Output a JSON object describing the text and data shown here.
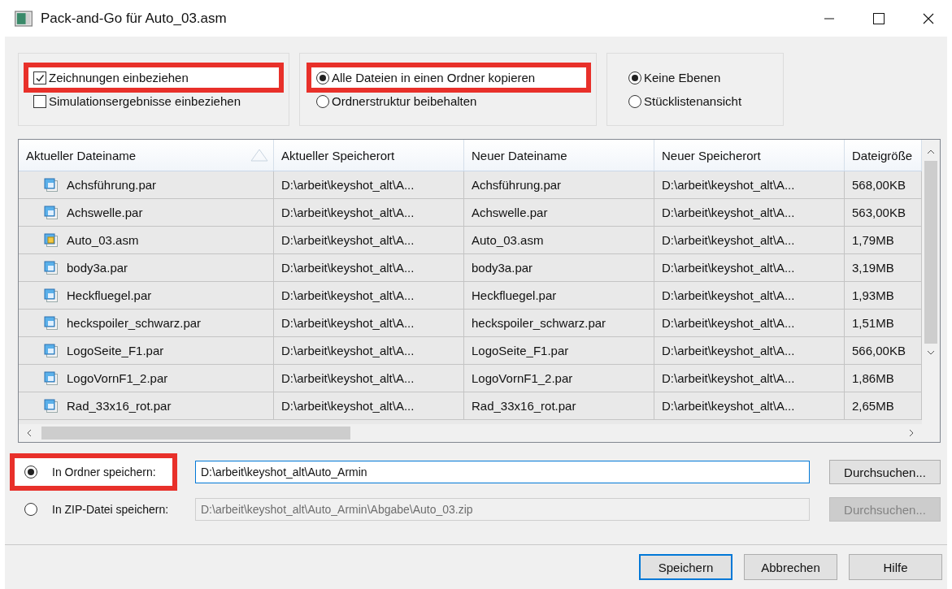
{
  "window": {
    "title": "Pack-and-Go für Auto_03.asm"
  },
  "option_groups": [
    {
      "kind": "checkbox",
      "items": [
        {
          "label": "Zeichnungen einbeziehen",
          "checked": true,
          "highlighted": true
        },
        {
          "label": "Simulationsergebnisse einbeziehen",
          "checked": false,
          "highlighted": false
        }
      ]
    },
    {
      "kind": "radio",
      "items": [
        {
          "label": "Alle Dateien in einen Ordner kopieren",
          "selected": true,
          "highlighted": true
        },
        {
          "label": "Ordnerstruktur beibehalten",
          "selected": false,
          "highlighted": false
        }
      ]
    },
    {
      "kind": "radio",
      "items": [
        {
          "label": "Keine Ebenen",
          "selected": true,
          "highlighted": false
        },
        {
          "label": "Stücklistenansicht",
          "selected": false,
          "highlighted": false
        }
      ]
    }
  ],
  "table": {
    "columns": [
      "Aktueller Dateiname",
      "Aktueller Speicherort",
      "Neuer Dateiname",
      "Neuer Speicherort",
      "Dateigröße"
    ],
    "rows": [
      {
        "kind": "part",
        "cells": [
          "Achsführung.par",
          "D:\\arbeit\\keyshot_alt\\A...",
          "Achsführung.par",
          "D:\\arbeit\\keyshot_alt\\A...",
          "568,00KB"
        ]
      },
      {
        "kind": "part",
        "cells": [
          "Achswelle.par",
          "D:\\arbeit\\keyshot_alt\\A...",
          "Achswelle.par",
          "D:\\arbeit\\keyshot_alt\\A...",
          "563,00KB"
        ]
      },
      {
        "kind": "assembly",
        "cells": [
          "Auto_03.asm",
          "D:\\arbeit\\keyshot_alt\\A...",
          "Auto_03.asm",
          "D:\\arbeit\\keyshot_alt\\A...",
          "1,79MB"
        ]
      },
      {
        "kind": "part",
        "cells": [
          "body3a.par",
          "D:\\arbeit\\keyshot_alt\\A...",
          "body3a.par",
          "D:\\arbeit\\keyshot_alt\\A...",
          "3,19MB"
        ]
      },
      {
        "kind": "part",
        "cells": [
          "Heckfluegel.par",
          "D:\\arbeit\\keyshot_alt\\A...",
          "Heckfluegel.par",
          "D:\\arbeit\\keyshot_alt\\A...",
          "1,93MB"
        ]
      },
      {
        "kind": "part",
        "cells": [
          "heckspoiler_schwarz.par",
          "D:\\arbeit\\keyshot_alt\\A...",
          "heckspoiler_schwarz.par",
          "D:\\arbeit\\keyshot_alt\\A...",
          "1,51MB"
        ]
      },
      {
        "kind": "part",
        "cells": [
          "LogoSeite_F1.par",
          "D:\\arbeit\\keyshot_alt\\A...",
          "LogoSeite_F1.par",
          "D:\\arbeit\\keyshot_alt\\A...",
          "566,00KB"
        ]
      },
      {
        "kind": "part",
        "cells": [
          "LogoVornF1_2.par",
          "D:\\arbeit\\keyshot_alt\\A...",
          "LogoVornF1_2.par",
          "D:\\arbeit\\keyshot_alt\\A...",
          "1,86MB"
        ]
      },
      {
        "kind": "part",
        "cells": [
          "Rad_33x16_rot.par",
          "D:\\arbeit\\keyshot_alt\\A...",
          "Rad_33x16_rot.par",
          "D:\\arbeit\\keyshot_alt\\A...",
          "2,65MB"
        ]
      }
    ]
  },
  "save_targets": [
    {
      "label": "In Ordner speichern:",
      "value": "D:\\arbeit\\keyshot_alt\\Auto_Armin",
      "button": "Durchsuchen...",
      "selected": true,
      "disabled": false,
      "highlighted": true
    },
    {
      "label": "In ZIP-Datei speichern:",
      "value": "D:\\arbeit\\keyshot_alt\\Auto_Armin\\Abgabe\\Auto_03.zip",
      "button": "Durchsuchen...",
      "selected": false,
      "disabled": true,
      "highlighted": false
    }
  ],
  "buttons": [
    {
      "label": "Speichern",
      "default": true
    },
    {
      "label": "Abbrechen",
      "default": false
    },
    {
      "label": "Hilfe",
      "default": false
    }
  ]
}
